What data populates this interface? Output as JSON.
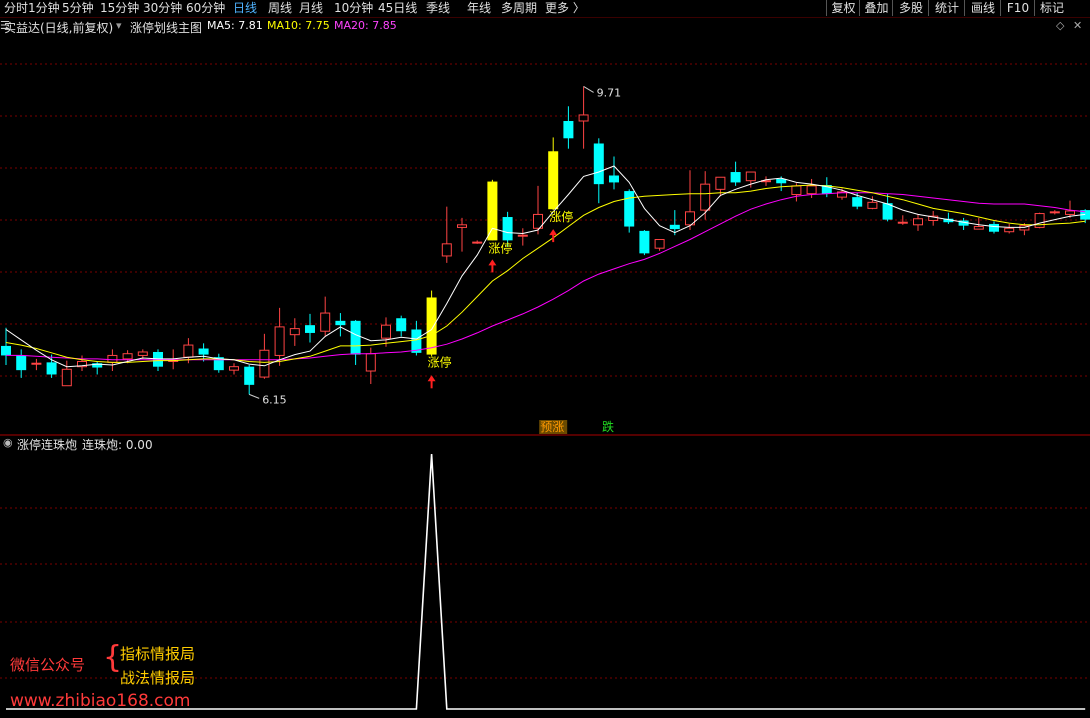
{
  "toolbar": {
    "tabs": [
      {
        "label": "分时",
        "active": false
      },
      {
        "label": "1分钟",
        "active": false
      },
      {
        "label": "5分钟",
        "active": false
      },
      {
        "label": "15分钟",
        "active": false
      },
      {
        "label": "30分钟",
        "active": false
      },
      {
        "label": "60分钟",
        "active": false
      },
      {
        "label": "日线",
        "active": true
      },
      {
        "label": "周线",
        "active": false
      },
      {
        "label": "月线",
        "active": false
      },
      {
        "label": "10分钟",
        "active": false
      },
      {
        "label": "45日线",
        "active": false
      },
      {
        "label": "季线",
        "active": false
      },
      {
        "label": "年线",
        "active": false
      },
      {
        "label": "多周期",
        "active": false
      },
      {
        "label": "更多 〉",
        "active": false
      }
    ],
    "right_buttons": [
      "复权",
      "叠加",
      "多股",
      "统计",
      "画线",
      "F10",
      "标记"
    ]
  },
  "chart_header": {
    "stock_label": "实益达(日线,前复权)",
    "formula_label": "涨停划线主图",
    "ma5": "MA5: 7.81",
    "ma10": "MA10: 7.75",
    "ma20": "MA20: 7.85"
  },
  "colors": {
    "up": "#ff4444",
    "down": "#00ffff",
    "limit_up": "#ffff00",
    "ma5": "#ffffff",
    "ma10": "#ffff00",
    "ma20": "#ff00ff",
    "grid": "#7a0000",
    "accent_tab": "#4fb3ff"
  },
  "chart_data": [
    {
      "type": "candlestick",
      "title": "涨停划线主图",
      "ylim": [
        5.9,
        10.2
      ],
      "high_label": "9.71",
      "low_label": "6.15",
      "limit_up_label": "涨停",
      "signal_up_label": "预涨",
      "signal_down_label": "跌",
      "candles": [
        {
          "o": 6.71,
          "h": 6.92,
          "l": 6.49,
          "c": 6.6
        },
        {
          "o": 6.6,
          "h": 6.67,
          "l": 6.34,
          "c": 6.43
        },
        {
          "o": 6.5,
          "h": 6.56,
          "l": 6.43,
          "c": 6.51
        },
        {
          "o": 6.52,
          "h": 6.61,
          "l": 6.34,
          "c": 6.38
        },
        {
          "o": 6.25,
          "h": 6.54,
          "l": 6.25,
          "c": 6.44
        },
        {
          "o": 6.47,
          "h": 6.6,
          "l": 6.42,
          "c": 6.53
        },
        {
          "o": 6.51,
          "h": 6.53,
          "l": 6.38,
          "c": 6.46
        },
        {
          "o": 6.52,
          "h": 6.67,
          "l": 6.42,
          "c": 6.6
        },
        {
          "o": 6.56,
          "h": 6.66,
          "l": 6.51,
          "c": 6.62
        },
        {
          "o": 6.6,
          "h": 6.67,
          "l": 6.56,
          "c": 6.64
        },
        {
          "o": 6.64,
          "h": 6.67,
          "l": 6.42,
          "c": 6.47
        },
        {
          "o": 6.53,
          "h": 6.67,
          "l": 6.44,
          "c": 6.55
        },
        {
          "o": 6.58,
          "h": 6.8,
          "l": 6.51,
          "c": 6.72
        },
        {
          "o": 6.68,
          "h": 6.74,
          "l": 6.53,
          "c": 6.61
        },
        {
          "o": 6.58,
          "h": 6.62,
          "l": 6.4,
          "c": 6.43
        },
        {
          "o": 6.43,
          "h": 6.51,
          "l": 6.38,
          "c": 6.47
        },
        {
          "o": 6.47,
          "h": 6.49,
          "l": 6.15,
          "c": 6.26
        },
        {
          "o": 6.35,
          "h": 6.85,
          "l": 6.33,
          "c": 6.66
        },
        {
          "o": 6.6,
          "h": 7.15,
          "l": 6.48,
          "c": 6.93
        },
        {
          "o": 6.84,
          "h": 7.03,
          "l": 6.71,
          "c": 6.91
        },
        {
          "o": 6.95,
          "h": 7.08,
          "l": 6.75,
          "c": 6.86
        },
        {
          "o": 6.88,
          "h": 7.28,
          "l": 6.82,
          "c": 7.09
        },
        {
          "o": 7.0,
          "h": 7.09,
          "l": 6.82,
          "c": 6.95
        },
        {
          "o": 7.0,
          "h": 7.01,
          "l": 6.49,
          "c": 6.61
        },
        {
          "o": 6.42,
          "h": 6.69,
          "l": 6.27,
          "c": 6.62
        },
        {
          "o": 6.8,
          "h": 7.04,
          "l": 6.7,
          "c": 6.95
        },
        {
          "o": 7.03,
          "h": 7.06,
          "l": 6.82,
          "c": 6.88
        },
        {
          "o": 6.9,
          "h": 7.0,
          "l": 6.6,
          "c": 6.63
        },
        {
          "o": 6.61,
          "h": 7.35,
          "l": 6.59,
          "c": 7.27,
          "limit": true
        },
        {
          "o": 7.75,
          "h": 8.32,
          "l": 7.67,
          "c": 7.89
        },
        {
          "o": 8.08,
          "h": 8.19,
          "l": 7.8,
          "c": 8.11
        },
        {
          "o": 7.9,
          "h": 7.93,
          "l": 7.89,
          "c": 7.91
        },
        {
          "o": 7.93,
          "h": 8.63,
          "l": 7.93,
          "c": 8.61,
          "limit": true
        },
        {
          "o": 8.2,
          "h": 8.26,
          "l": 7.86,
          "c": 7.93
        },
        {
          "o": 7.98,
          "h": 8.07,
          "l": 7.87,
          "c": 7.99
        },
        {
          "o": 8.07,
          "h": 8.56,
          "l": 8.0,
          "c": 8.23
        },
        {
          "o": 8.29,
          "h": 9.12,
          "l": 8.28,
          "c": 8.96,
          "limit": true
        },
        {
          "o": 9.31,
          "h": 9.48,
          "l": 8.99,
          "c": 9.11
        },
        {
          "o": 9.31,
          "h": 9.71,
          "l": 8.99,
          "c": 9.38
        },
        {
          "o": 9.05,
          "h": 9.11,
          "l": 8.36,
          "c": 8.58
        },
        {
          "o": 8.68,
          "h": 8.9,
          "l": 8.52,
          "c": 8.6
        },
        {
          "o": 8.5,
          "h": 8.52,
          "l": 8.02,
          "c": 8.09
        },
        {
          "o": 8.04,
          "h": 8.05,
          "l": 7.76,
          "c": 7.78
        },
        {
          "o": 7.84,
          "h": 7.91,
          "l": 7.81,
          "c": 7.94
        },
        {
          "o": 8.11,
          "h": 8.28,
          "l": 7.99,
          "c": 8.06
        },
        {
          "o": 8.11,
          "h": 8.74,
          "l": 8.05,
          "c": 8.26
        },
        {
          "o": 8.28,
          "h": 8.73,
          "l": 8.17,
          "c": 8.58
        },
        {
          "o": 8.52,
          "h": 8.6,
          "l": 8.44,
          "c": 8.66
        },
        {
          "o": 8.72,
          "h": 8.84,
          "l": 8.56,
          "c": 8.6
        },
        {
          "o": 8.62,
          "h": 8.71,
          "l": 8.54,
          "c": 8.72
        },
        {
          "o": 8.61,
          "h": 8.67,
          "l": 8.56,
          "c": 8.62
        },
        {
          "o": 8.64,
          "h": 8.67,
          "l": 8.5,
          "c": 8.59
        },
        {
          "o": 8.46,
          "h": 8.59,
          "l": 8.38,
          "c": 8.56
        },
        {
          "o": 8.47,
          "h": 8.64,
          "l": 8.42,
          "c": 8.56
        },
        {
          "o": 8.57,
          "h": 8.66,
          "l": 8.43,
          "c": 8.47
        },
        {
          "o": 8.43,
          "h": 8.53,
          "l": 8.4,
          "c": 8.49
        },
        {
          "o": 8.43,
          "h": 8.48,
          "l": 8.29,
          "c": 8.32
        },
        {
          "o": 8.3,
          "h": 8.44,
          "l": 8.29,
          "c": 8.37
        },
        {
          "o": 8.36,
          "h": 8.47,
          "l": 8.15,
          "c": 8.17
        },
        {
          "o": 8.13,
          "h": 8.22,
          "l": 8.11,
          "c": 8.14
        },
        {
          "o": 8.11,
          "h": 8.23,
          "l": 8.04,
          "c": 8.18
        },
        {
          "o": 8.16,
          "h": 8.27,
          "l": 8.1,
          "c": 8.21
        },
        {
          "o": 8.18,
          "h": 8.25,
          "l": 8.12,
          "c": 8.14
        },
        {
          "o": 8.16,
          "h": 8.19,
          "l": 8.05,
          "c": 8.1
        },
        {
          "o": 8.06,
          "h": 8.19,
          "l": 8.06,
          "c": 8.09
        },
        {
          "o": 8.12,
          "h": 8.15,
          "l": 8.01,
          "c": 8.03
        },
        {
          "o": 8.03,
          "h": 8.12,
          "l": 8.01,
          "c": 8.07
        },
        {
          "o": 8.05,
          "h": 8.13,
          "l": 7.99,
          "c": 8.1
        },
        {
          "o": 8.08,
          "h": 8.25,
          "l": 8.07,
          "c": 8.24
        },
        {
          "o": 8.26,
          "h": 8.28,
          "l": 8.23,
          "c": 8.26
        },
        {
          "o": 8.23,
          "h": 8.39,
          "l": 8.19,
          "c": 8.27
        },
        {
          "o": 8.28,
          "h": 8.29,
          "l": 8.13,
          "c": 8.17
        }
      ],
      "ma5": [
        6.9,
        6.78,
        6.66,
        6.55,
        6.47,
        6.48,
        6.5,
        6.49,
        6.53,
        6.57,
        6.56,
        6.56,
        6.58,
        6.59,
        6.56,
        6.55,
        6.5,
        6.48,
        6.55,
        6.61,
        6.65,
        6.82,
        6.93,
        6.84,
        6.77,
        6.78,
        6.81,
        6.79,
        6.9,
        7.2,
        7.52,
        7.76,
        8.07,
        8.02,
        8.01,
        8.05,
        8.26,
        8.46,
        8.67,
        8.72,
        8.79,
        8.6,
        8.3,
        8.1,
        8.02,
        8.1,
        8.25,
        8.45,
        8.52,
        8.58,
        8.63,
        8.65,
        8.6,
        8.58,
        8.55,
        8.51,
        8.45,
        8.4,
        8.35,
        8.28,
        8.23,
        8.2,
        8.17,
        8.14,
        8.11,
        8.09,
        8.08,
        8.08,
        8.13,
        8.17,
        8.21,
        8.23
      ],
      "ma10": [
        6.75,
        6.72,
        6.68,
        6.63,
        6.58,
        6.55,
        6.53,
        6.52,
        6.52,
        6.53,
        6.54,
        6.54,
        6.55,
        6.56,
        6.56,
        6.55,
        6.53,
        6.52,
        6.53,
        6.56,
        6.59,
        6.65,
        6.71,
        6.71,
        6.72,
        6.74,
        6.76,
        6.78,
        6.83,
        6.94,
        7.1,
        7.28,
        7.46,
        7.58,
        7.72,
        7.84,
        7.96,
        8.09,
        8.22,
        8.31,
        8.38,
        8.42,
        8.44,
        8.45,
        8.46,
        8.47,
        8.47,
        8.48,
        8.48,
        8.5,
        8.53,
        8.55,
        8.56,
        8.57,
        8.56,
        8.54,
        8.51,
        8.48,
        8.44,
        8.4,
        8.35,
        8.3,
        8.27,
        8.24,
        8.2,
        8.16,
        8.13,
        8.11,
        8.11,
        8.12,
        8.13,
        8.15
      ],
      "ma20": [
        6.6,
        6.6,
        6.59,
        6.58,
        6.57,
        6.56,
        6.56,
        6.55,
        6.55,
        6.55,
        6.55,
        6.55,
        6.55,
        6.55,
        6.55,
        6.55,
        6.55,
        6.55,
        6.55,
        6.56,
        6.57,
        6.59,
        6.61,
        6.62,
        6.62,
        6.63,
        6.64,
        6.66,
        6.69,
        6.73,
        6.79,
        6.86,
        6.94,
        7.01,
        7.08,
        7.16,
        7.25,
        7.35,
        7.46,
        7.54,
        7.6,
        7.66,
        7.71,
        7.78,
        7.86,
        7.94,
        8.03,
        8.12,
        8.21,
        8.29,
        8.35,
        8.4,
        8.44,
        8.46,
        8.47,
        8.48,
        8.48,
        8.48,
        8.47,
        8.46,
        8.44,
        8.42,
        8.4,
        8.38,
        8.36,
        8.35,
        8.35,
        8.35,
        8.33,
        8.31,
        8.28,
        8.26
      ],
      "arrow_candles": [
        28,
        32,
        36
      ],
      "signal_up_index": 36,
      "signal_down_index": 40
    },
    {
      "type": "line",
      "title": "涨停连珠炮",
      "series": [
        {
          "name": "连珠炮",
          "values": [
            0,
            0,
            0,
            0,
            0,
            0,
            0,
            0,
            0,
            0,
            0,
            0,
            0,
            0,
            0,
            0,
            0,
            0,
            0,
            0,
            0,
            0,
            0,
            0,
            0,
            0,
            0,
            0,
            1,
            0,
            0,
            0,
            0,
            0,
            0,
            0,
            0,
            0,
            0,
            0,
            0,
            0,
            0,
            0,
            0,
            0,
            0,
            0,
            0,
            0,
            0,
            0,
            0,
            0,
            0,
            0,
            0,
            0,
            0,
            0,
            0,
            0,
            0,
            0,
            0,
            0,
            0,
            0,
            0,
            0,
            0,
            0
          ]
        }
      ],
      "ylim": [
        0,
        1
      ]
    }
  ],
  "indicator_header": {
    "name": "涨停连珠炮",
    "value_label": "连珠炮: 0.00"
  },
  "watermark": {
    "left": "微信公众号",
    "brace": "{",
    "line1": "指标情报局",
    "line2": "战法情报局",
    "url": "www.zhibiao168.com"
  }
}
